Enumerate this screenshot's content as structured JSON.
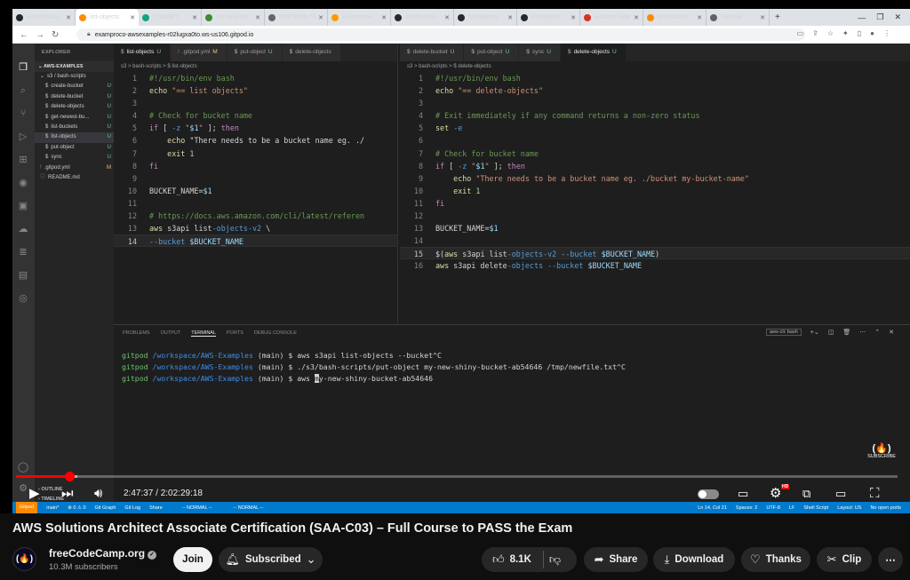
{
  "browser": {
    "tabs": [
      {
        "label": "ExamProCo",
        "color": "#24292e"
      },
      {
        "label": "list-objects",
        "color": "#ff8a00",
        "active": true
      },
      {
        "label": "ChatGPT",
        "color": "#10a37f"
      },
      {
        "label": "my-new-shi",
        "color": "#3c8d2f"
      },
      {
        "label": "JMESPath Tu",
        "color": "#666"
      },
      {
        "label": "Environme",
        "color": "#ff9900"
      },
      {
        "label": "delete-obje",
        "color": "#24292e"
      },
      {
        "label": "list-objects",
        "color": "#24292e"
      },
      {
        "label": "list-objects",
        "color": "#24292e"
      },
      {
        "label": "amazon web",
        "color": "#d93025"
      },
      {
        "label": "list-buckets",
        "color": "#ff8a00"
      },
      {
        "label": "Tutorial",
        "color": "#5f6368"
      }
    ],
    "new_tab": "+",
    "url": "examproco-awsexamples-r02lugxa0to.ws-us106.gitpod.io"
  },
  "vscode": {
    "explorer_title": "EXPLORER",
    "workspace": "AWS-EXAMPLES",
    "tree": [
      {
        "label": "s3 / bash-scripts",
        "status": "",
        "icon": "folder-icon",
        "indent": 6
      },
      {
        "label": "create-bucket",
        "status": "U",
        "icon": "dollar-icon",
        "indent": 12
      },
      {
        "label": "delete-bucket",
        "status": "U",
        "icon": "dollar-icon",
        "indent": 12
      },
      {
        "label": "delete-objects",
        "status": "U",
        "icon": "dollar-icon",
        "indent": 12
      },
      {
        "label": "get-newest-bu...",
        "status": "U",
        "icon": "dollar-icon",
        "indent": 12
      },
      {
        "label": "list-buckets",
        "status": "U",
        "icon": "dollar-icon",
        "indent": 12
      },
      {
        "label": "list-objects",
        "status": "U",
        "icon": "dollar-icon",
        "indent": 12,
        "selected": true
      },
      {
        "label": "put-object",
        "status": "U",
        "icon": "dollar-icon",
        "indent": 12
      },
      {
        "label": "sync",
        "status": "U",
        "icon": "dollar-icon",
        "indent": 12
      },
      {
        "label": ".gitpod.yml",
        "status": "M",
        "icon": "yaml-icon",
        "indent": 6
      },
      {
        "label": "README.md",
        "status": "",
        "icon": "info-icon",
        "indent": 6
      }
    ],
    "outline": "OUTLINE",
    "timeline": "TIMELINE",
    "left_tabs": [
      {
        "label": "list-objects",
        "status": "U",
        "active": true
      },
      {
        "label": ".gitpod.yml",
        "status": "M"
      },
      {
        "label": "put-object",
        "status": "U"
      },
      {
        "label": "delete-objects",
        "status": ""
      }
    ],
    "right_tabs": [
      {
        "label": "delete-bucket",
        "status": "U"
      },
      {
        "label": "put-object",
        "status": "U"
      },
      {
        "label": "sync",
        "status": "U"
      },
      {
        "label": "delete-objects",
        "status": "U",
        "active": true
      }
    ],
    "left_crumbs": "s3 > bash-scripts > $ list-objects",
    "right_crumbs": "s3 > bash-scripts > $ delete-objects",
    "left_code": [
      "#!/usr/bin/env bash",
      "echo \"== list objects\"",
      "",
      "# Check for bucket name",
      "if [ -z \"$1\" ]; then",
      "    echo \"There needs to be a bucket name eg. ./",
      "    exit 1",
      "fi",
      "",
      "BUCKET_NAME=$1",
      "",
      "# https://docs.aws.amazon.com/cli/latest/referen",
      "aws s3api list-objects-v2 \\",
      "--bucket $BUCKET_NAME"
    ],
    "right_code": [
      "#!/usr/bin/env bash",
      "echo \"== delete-objects\"",
      "",
      "# Exit immediately if any command returns a non-zero status",
      "set -e",
      "",
      "# Check for bucket name",
      "if [ -z \"$1\" ]; then",
      "    echo \"There needs to be a bucket name eg. ./bucket my-bucket-name\"",
      "    exit 1",
      "fi",
      "",
      "BUCKET_NAME=$1",
      "",
      "$(aws s3api list-objects-v2 --bucket $BUCKET_NAME)",
      "aws s3api delete-objects --bucket $BUCKET_NAME"
    ],
    "panel_tabs": [
      "PROBLEMS",
      "OUTPUT",
      "TERMINAL",
      "PORTS",
      "DEBUG CONSOLE"
    ],
    "terminal_name": "aws-cli: bash",
    "terminal": {
      "prompt_user": "gitpod",
      "prompt_path": "/workspace/AWS-Examples",
      "prompt_branch": "(main) $",
      "line1_cmd": "aws s3api list-objects --bucket^C",
      "line2_cmd": "./s3/bash-scripts/put-object my-new-shiny-bucket-ab54646 /tmp/newfile.txt^C",
      "line3_pre": "aws ",
      "line3_caret": "m",
      "line3_post": "y-new-shiny-bucket-ab54646"
    },
    "status": {
      "gitpod": "Gitpod",
      "branch": "main*",
      "problems": "⊗ 0 ⚠ 0",
      "gitgraph": "Git Graph",
      "gitlog": "Git Log",
      "share": "Share",
      "normal1": "-- NORMAL --",
      "normal2": "-- NORMAL --",
      "position": "Ln 14, Col 21",
      "spaces": "Spaces: 2",
      "encoding": "UTF-8",
      "eol": "LF",
      "lang": "Shell Script",
      "layout": "Layout: US",
      "ports": "No open ports"
    }
  },
  "player": {
    "subscribe_label": "SUBSCRIBE",
    "time_current": "2:47:37",
    "time_total": "2:02:29:18",
    "time_sep": " / ",
    "progress_played": 0.06,
    "progress_buffered": 0.07,
    "hd_badge": "HD"
  },
  "video": {
    "title": "AWS Solutions Architect Associate Certification (SAA-C03) – Full Course to PASS the Exam",
    "channel": "freeCodeCamp.org",
    "subscribers": "10.3M subscribers",
    "join": "Join",
    "subscribed": "Subscribed",
    "likes": "8.1K",
    "share": "Share",
    "download": "Download",
    "thanks": "Thanks",
    "clip": "Clip",
    "more": "⋯"
  }
}
